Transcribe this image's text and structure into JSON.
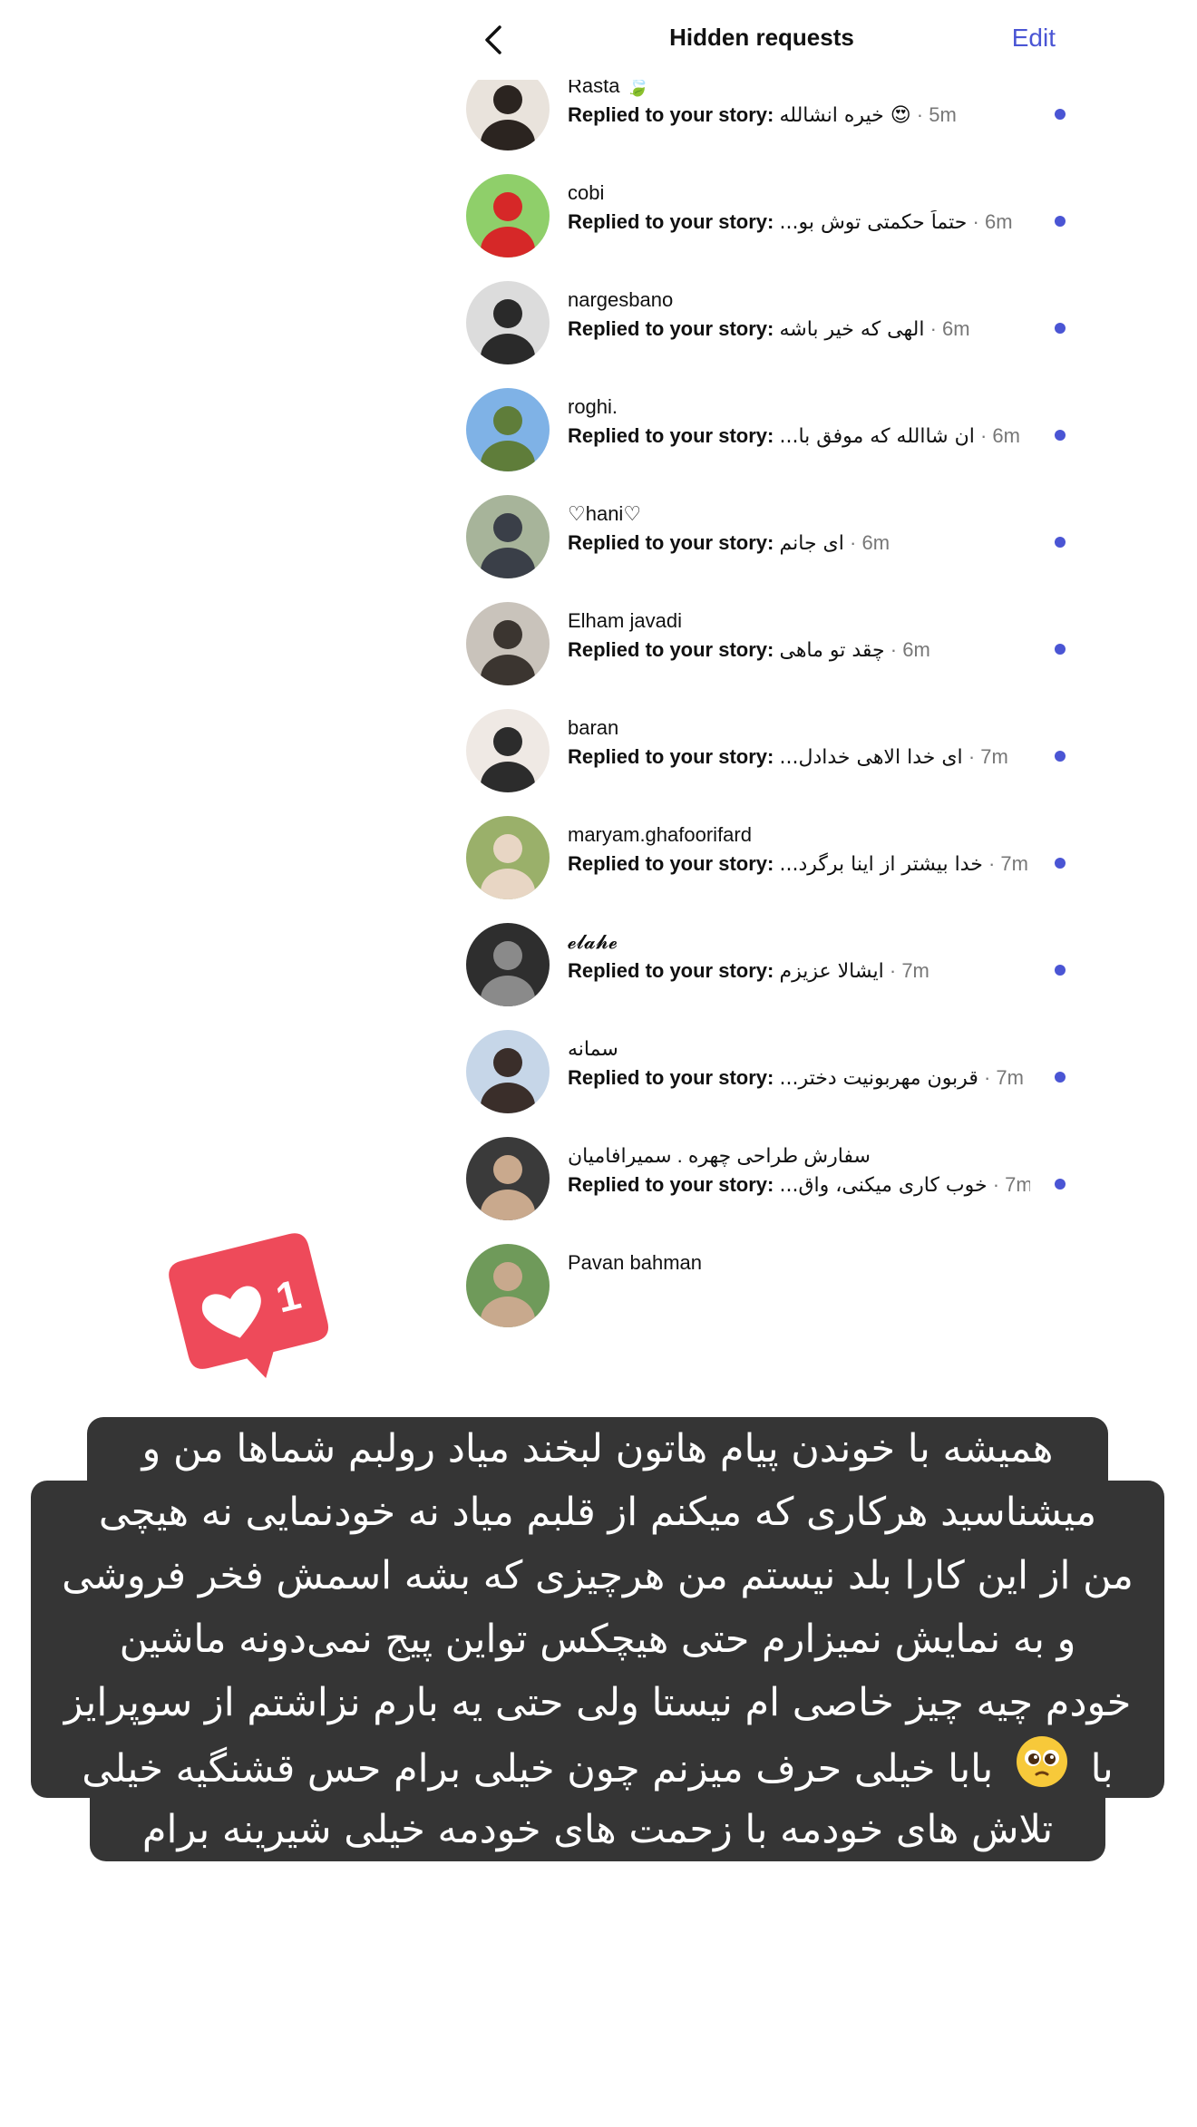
{
  "header": {
    "title": "Hidden requests",
    "edit_label": "Edit"
  },
  "colors": {
    "accent": "#4a55d4",
    "unread_dot": "#4a55d4",
    "like_badge": "#ee4a5a",
    "caption_bg": "#353535"
  },
  "reply_prefix": "Replied to your story:",
  "requests": [
    {
      "username": "",
      "message": "",
      "time": "",
      "partial": true
    },
    {
      "username": "Rasta 🍃",
      "message": "😍 خیره انشالله",
      "time": "· 5m"
    },
    {
      "username": "cobi",
      "message": "حتماً حکمتی توش بو...",
      "time": "· 6m"
    },
    {
      "username": "nargesbano",
      "message": "الهی که خیر باشه",
      "time": "· 6m"
    },
    {
      "username": "roghi.",
      "message": "ان شاالله که موفق با...",
      "time": "· 6m"
    },
    {
      "username": "♡hani♡",
      "message": "ای جانم",
      "time": "· 6m"
    },
    {
      "username": "Elham javadi",
      "message": "چقد تو ماهی",
      "time": "· 6m"
    },
    {
      "username": "baran",
      "message": "ای خدا الاهی خدادل...",
      "time": "· 7m"
    },
    {
      "username": "maryam.ghafoorifard",
      "message": "خدا بیشتر از اینا برگرد...",
      "time": "· 7m"
    },
    {
      "username": "𝓮𝓵𝓪𝓱𝓮",
      "message": "ایشالا عزیزم",
      "time": "· 7m"
    },
    {
      "username": "سمانه",
      "message": "قربون مهربونیت دختر...",
      "time": "· 7m"
    },
    {
      "username": "سفارش طراحی چهره . سمیرافامیان",
      "message": "خوب کاری میکنی، واق...",
      "time": "· 7m"
    },
    {
      "username": "Pavan bahman",
      "message": "",
      "time": "",
      "partial": true
    }
  ],
  "like_badge": {
    "count": "1",
    "icon": "heart-icon"
  },
  "caption": {
    "lines": [
      "همیشه با خوندن پیام هاتون لبخند میاد رولبم شماها من و",
      "میشناسید هرکاری که میکنم از قلبم میاد نه خودنمایی نه هیچی",
      "من از این کارا بلد نیستم من هرچیزی که بشه اسمش فخر فروشی",
      "و به نمایش نمیزارم حتی هیچکس تواین پیج نمی‌دونه ماشین",
      "خودم چیه چیز خاصی ام نیستا ولی حتی یه بارم نزاشتم از سوپرایز",
      "بابا خیلی حرف میزنم چون خیلی برام حس قشنگیه خیلی",
      "با",
      "تلاش های خودمه با زحمت های خودمه خیلی شیرینه برام"
    ],
    "emoji": "pleading-face-emoji"
  }
}
